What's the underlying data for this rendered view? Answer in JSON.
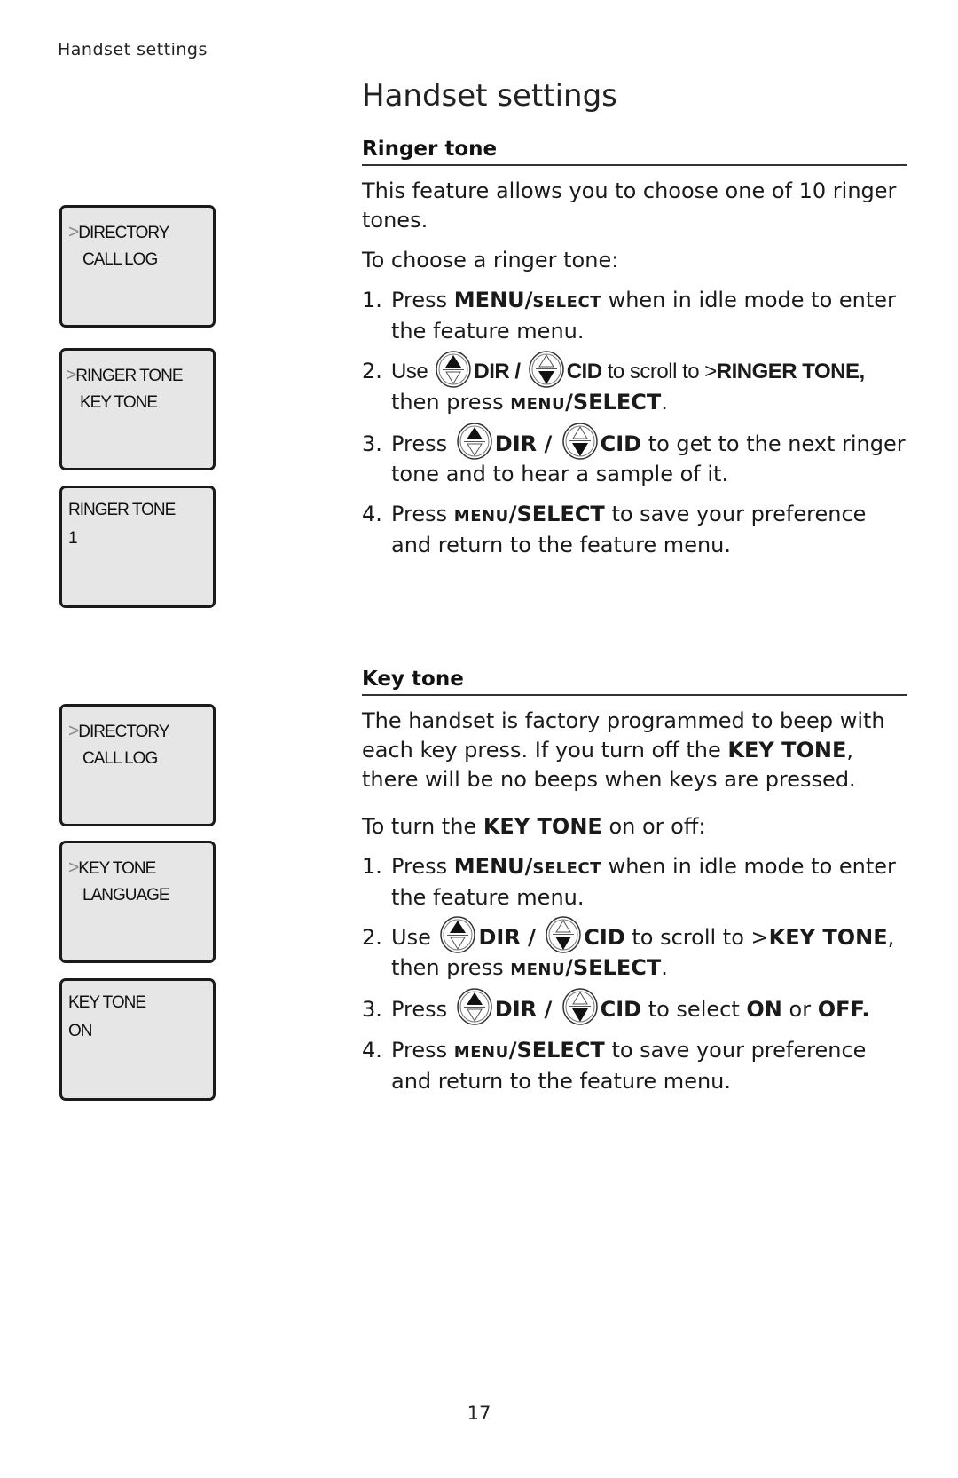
{
  "running_head": "Handset settings",
  "page_title": "Handset settings",
  "page_number": "17",
  "lcd_screens": [
    {
      "caret": ">",
      "line1": "DIRECTORY",
      "line2": "CALL LOG"
    },
    {
      "caret": ">",
      "line1": "RINGER TONE",
      "line2": "KEY TONE"
    },
    {
      "caret": "",
      "line1": "RINGER TONE",
      "line2": "1"
    },
    {
      "caret": ">",
      "line1": "DIRECTORY",
      "line2": "CALL LOG"
    },
    {
      "caret": ">",
      "line1": "KEY TONE",
      "line2": "LANGUAGE"
    },
    {
      "caret": "",
      "line1": "KEY TONE",
      "line2": "ON"
    }
  ],
  "icons": {
    "up": "dir-up-key-icon",
    "down": "cid-down-key-icon"
  },
  "ringer": {
    "heading": "Ringer tone",
    "intro": "This feature allows you to choose one of 10 ringer tones.",
    "lead": "To choose a ringer tone:",
    "steps": [
      {
        "num": "1.",
        "pre": "Press ",
        "menu": "MENU/",
        "select": "SELECT",
        "post": " when in idle mode to enter the feature menu."
      },
      {
        "num": "2.",
        "pre": "Use ",
        "dir": "DIR / ",
        "cid": "CID",
        "mid": " to scroll to >",
        "target": "RINGER TONE,",
        "then": "then press ",
        "menu": "MENU",
        "select": "/SELECT",
        "end": "."
      },
      {
        "num": "3.",
        "pre": "Press ",
        "dir": "DIR / ",
        "cid": "CID",
        "post": " to get to the next ringer tone and to hear a sample of it."
      },
      {
        "num": "4.",
        "pre": "Press ",
        "menu": "MENU",
        "select": "/SELECT",
        "post": " to save your preference and return to the feature menu."
      }
    ]
  },
  "keytone": {
    "heading": "Key tone",
    "intro_a": "The handset is factory programmed to beep with each key press. If you turn off the ",
    "intro_b": "KEY TONE",
    "intro_c": ", there will be no beeps when keys are pressed.",
    "lead_a": "To turn the ",
    "lead_b": "KEY TONE",
    "lead_c": " on or off:",
    "steps": [
      {
        "num": "1.",
        "pre": "Press ",
        "menu": "MENU/",
        "select": "SELECT",
        "post": " when in idle mode to enter the feature menu."
      },
      {
        "num": "2.",
        "pre": "Use ",
        "dir": "DIR / ",
        "cid": "CID",
        "mid": " to scroll to >",
        "target": "KEY TONE",
        "comma": ",",
        "then": "then press ",
        "menu": "MENU",
        "select": "/SELECT",
        "end": "."
      },
      {
        "num": "3.",
        "pre": "Press ",
        "dir": "DIR / ",
        "cid": "CID",
        "mid": " to select ",
        "on": "ON",
        "or": " or ",
        "off": "OFF."
      },
      {
        "num": "4.",
        "pre": "Press ",
        "menu": "MENU",
        "select": "/SELECT",
        "post": " to save your preference and return to the feature menu."
      }
    ]
  }
}
